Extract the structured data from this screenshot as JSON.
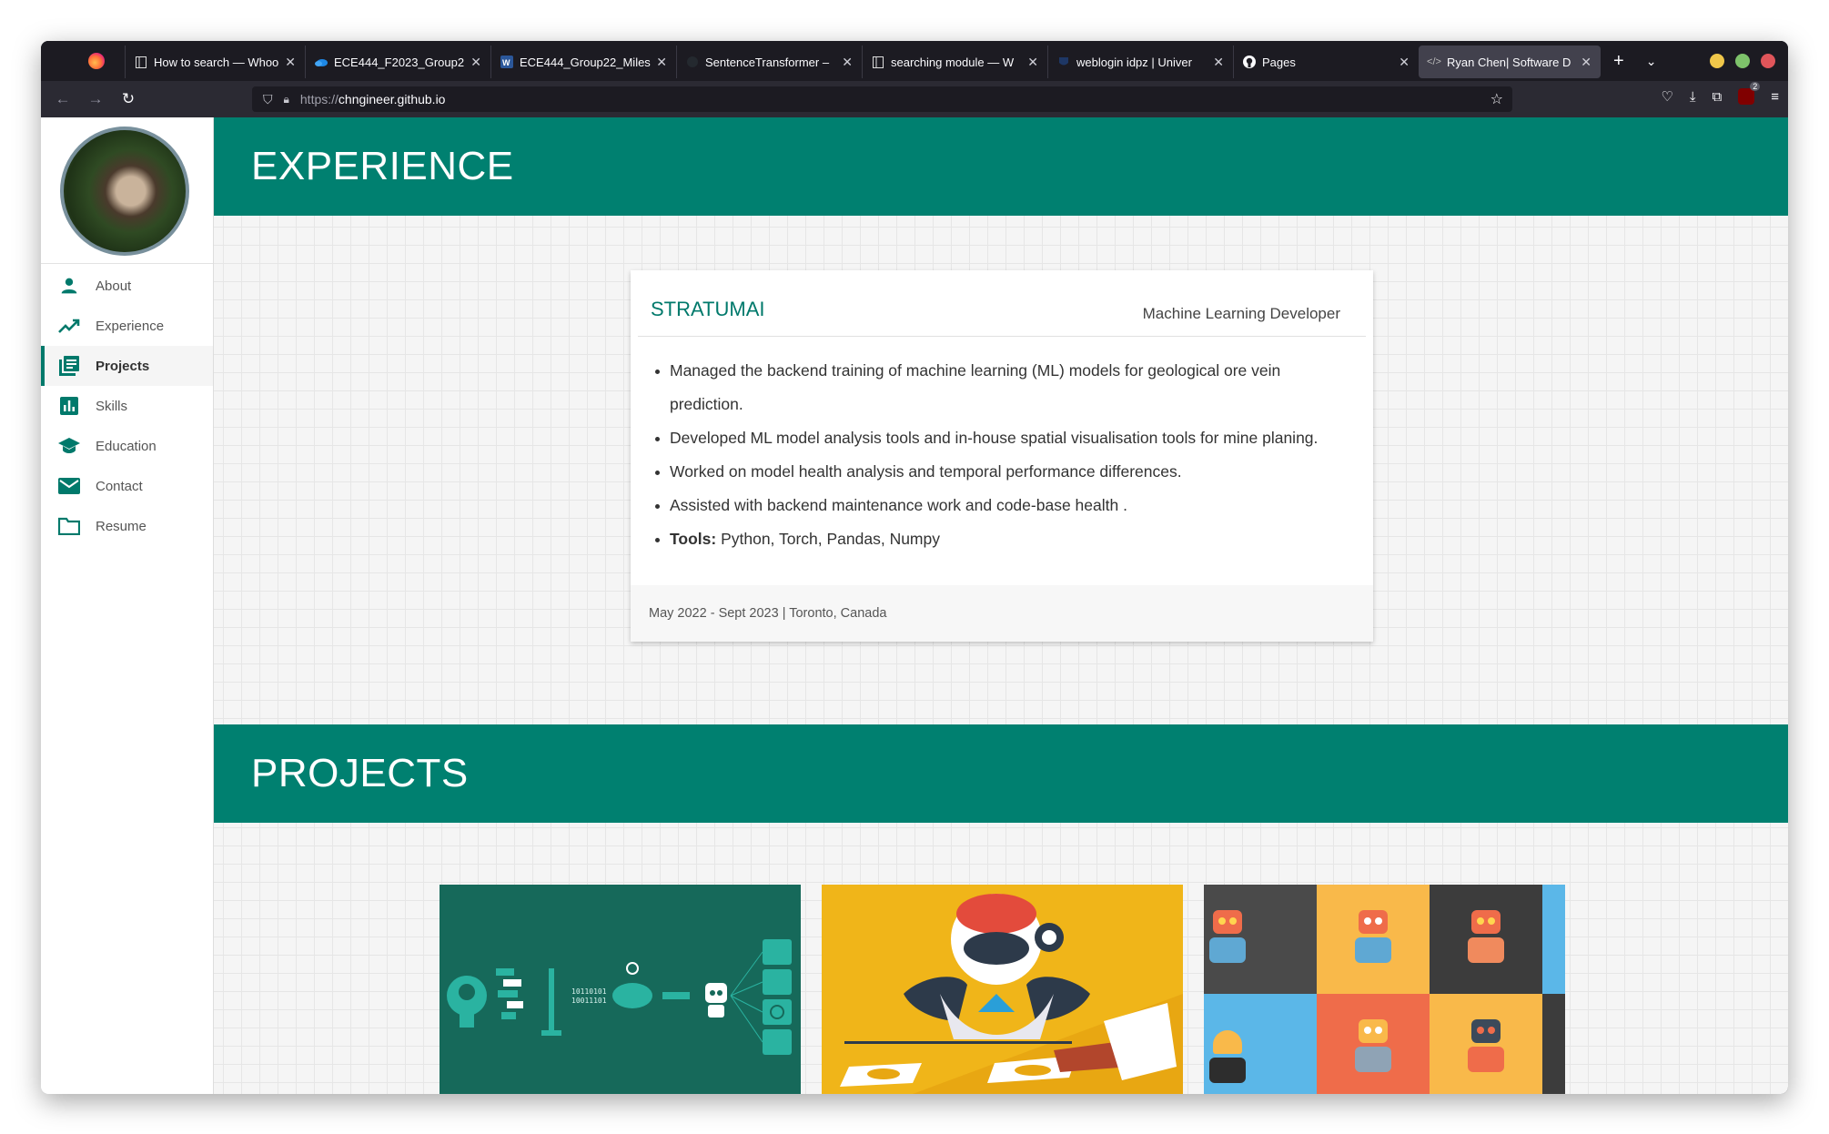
{
  "browser": {
    "tabs": [
      {
        "label": "How to search — Whoo",
        "icon": "notebook-icon"
      },
      {
        "label": "ECE444_F2023_Group2",
        "icon": "onedrive-icon"
      },
      {
        "label": "ECE444_Group22_Miles",
        "icon": "word-icon"
      },
      {
        "label": "SentenceTransformer –",
        "icon": "github-dark-icon"
      },
      {
        "label": "searching module — W",
        "icon": "notebook-icon"
      },
      {
        "label": "weblogin idpz | Univer",
        "icon": "uoft-icon"
      },
      {
        "label": "Pages",
        "icon": "github-icon"
      },
      {
        "label": "Ryan Chen| Software D",
        "icon": "code-icon",
        "active": true
      }
    ],
    "url_scheme": "https://",
    "url_host": "chngineer.github.io",
    "extension_badge": "2"
  },
  "sidebar": {
    "items": [
      {
        "label": "About",
        "icon": "person-icon"
      },
      {
        "label": "Experience",
        "icon": "trending-up-icon"
      },
      {
        "label": "Projects",
        "icon": "library-books-icon",
        "active": true
      },
      {
        "label": "Skills",
        "icon": "bar-chart-icon"
      },
      {
        "label": "Education",
        "icon": "school-icon"
      },
      {
        "label": "Contact",
        "icon": "mail-icon"
      },
      {
        "label": "Resume",
        "icon": "folder-icon"
      }
    ]
  },
  "experience": {
    "title": "EXPERIENCE",
    "company": "STRATUMAI",
    "role": "Machine Learning Developer",
    "bullets": [
      "Managed the backend training of machine learning (ML) models for geological ore vein prediction.",
      "Developed ML model analysis tools and in-house spatial visualisation tools for mine planing.",
      "Worked on model health analysis and temporal performance differences.",
      "Assisted with backend maintenance work and code-base health ."
    ],
    "tools_label": "Tools:",
    "tools": "Python, Torch, Pandas, Numpy",
    "footer": "May 2022 - Sept 2023 | Toronto, Canada"
  },
  "projects": {
    "title": "PROJECTS",
    "binary_text_1": "10110101",
    "binary_text_2": "10011101"
  },
  "colors": {
    "primary": "#008070",
    "accent": "#00796b"
  }
}
